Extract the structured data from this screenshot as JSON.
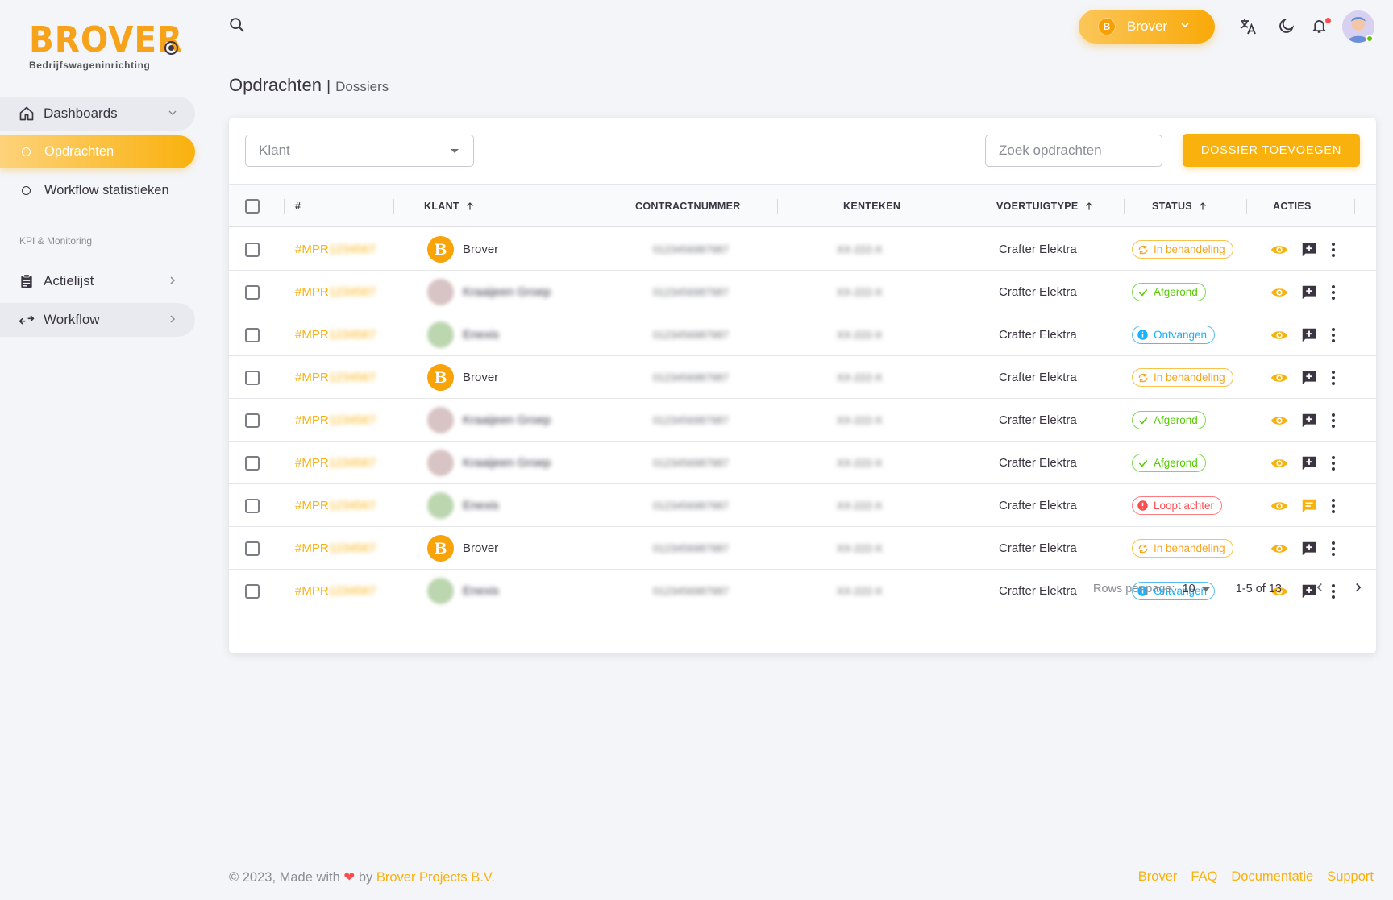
{
  "brand": {
    "logo_text": "BROVER",
    "logo_subtitle": "Bedrijfswageninrichting"
  },
  "sidebar": {
    "dashboards": "Dashboards",
    "items": [
      {
        "label": "Opdrachten",
        "active": true
      },
      {
        "label": "Workflow statistieken",
        "active": false
      }
    ],
    "section_label": "KPI & Monitoring",
    "actielijst": "Actielijst",
    "workflow": "Workflow"
  },
  "topbar": {
    "tenant_initial": "B",
    "tenant_name": "Brover",
    "icons": [
      "search-icon",
      "translate-icon",
      "moon-icon",
      "bell-icon"
    ]
  },
  "page": {
    "title": "Opdrachten",
    "separator": "|",
    "subtitle": "Dossiers"
  },
  "toolbar": {
    "klant_placeholder": "Klant",
    "search_placeholder": "Zoek opdrachten",
    "add_label": "DOSSIER TOEVOEGEN"
  },
  "table": {
    "columns": {
      "id": "#",
      "klant": "KLANT",
      "contract": "CONTRACTNUMMER",
      "kenteken": "KENTEKEN",
      "voertuigtype": "VOERTUIGTYPE",
      "status": "STATUS",
      "acties": "ACTIES"
    },
    "rows": [
      {
        "id": "#MPR",
        "id_hidden": "1234567",
        "klant": "Brover",
        "klant_type": "badge",
        "contract": "0123456987987",
        "kenteken": "XX-222-X",
        "voertuig": "Crafter Elektra",
        "status": "In behandeling",
        "status_kind": "orange",
        "comment_highlight": false
      },
      {
        "id": "#MPR",
        "id_hidden": "1234567",
        "klant": "Kraaijeen Groep",
        "klant_type": "photo",
        "contract": "0123456987987",
        "kenteken": "XX-222-X",
        "voertuig": "Crafter Elektra",
        "status": "Afgerond",
        "status_kind": "green",
        "comment_highlight": false
      },
      {
        "id": "#MPR",
        "id_hidden": "1234567",
        "klant": "Enexis",
        "klant_type": "photo-green",
        "contract": "0123456987987",
        "kenteken": "XX-222-X",
        "voertuig": "Crafter Elektra",
        "status": "Ontvangen",
        "status_kind": "blue",
        "comment_highlight": false
      },
      {
        "id": "#MPR",
        "id_hidden": "1234567",
        "klant": "Brover",
        "klant_type": "badge",
        "contract": "0123456987987",
        "kenteken": "XX-222-X",
        "voertuig": "Crafter Elektra",
        "status": "In behandeling",
        "status_kind": "orange",
        "comment_highlight": false
      },
      {
        "id": "#MPR",
        "id_hidden": "1234567",
        "klant": "Kraaijeen Groep",
        "klant_type": "photo",
        "contract": "0123456987987",
        "kenteken": "XX-222-X",
        "voertuig": "Crafter Elektra",
        "status": "Afgerond",
        "status_kind": "green",
        "comment_highlight": false
      },
      {
        "id": "#MPR",
        "id_hidden": "1234567",
        "klant": "Kraaijeen Groep",
        "klant_type": "photo",
        "contract": "0123456987987",
        "kenteken": "XX-222-X",
        "voertuig": "Crafter Elektra",
        "status": "Afgerond",
        "status_kind": "green",
        "comment_highlight": false
      },
      {
        "id": "#MPR",
        "id_hidden": "1234567",
        "klant": "Enexis",
        "klant_type": "photo-green",
        "contract": "0123456987987",
        "kenteken": "XX-222-X",
        "voertuig": "Crafter Elektra",
        "status": "Loopt achter",
        "status_kind": "red",
        "comment_highlight": true
      },
      {
        "id": "#MPR",
        "id_hidden": "1234567",
        "klant": "Brover",
        "klant_type": "badge",
        "contract": "0123456987987",
        "kenteken": "XX-222-X",
        "voertuig": "Crafter Elektra",
        "status": "In behandeling",
        "status_kind": "orange",
        "comment_highlight": false
      },
      {
        "id": "#MPR",
        "id_hidden": "1234567",
        "klant": "Enexis",
        "klant_type": "photo-green",
        "contract": "0123456987987",
        "kenteken": "XX-222-X",
        "voertuig": "Crafter Elektra",
        "status": "Ontvangen",
        "status_kind": "blue",
        "comment_highlight": false
      }
    ]
  },
  "pagination": {
    "rows_label": "Rows per page:",
    "rows_value": "10",
    "range": "1-5 of 13"
  },
  "footer": {
    "copyright": "© 2023, Made with",
    "by": "by",
    "company": "Brover Projects B.V.",
    "links": [
      "Brover",
      "FAQ",
      "Documentatie",
      "Support"
    ]
  },
  "colors": {
    "accent": "#f9b10d",
    "green": "#56ca00",
    "blue": "#16b1ff",
    "red": "#ff4c51"
  }
}
